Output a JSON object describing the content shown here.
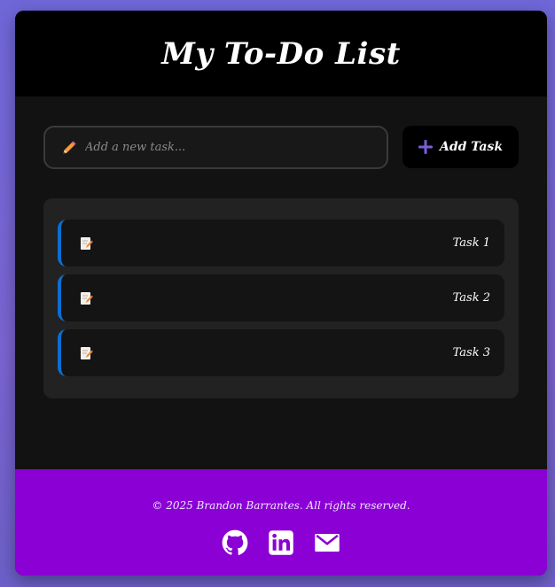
{
  "header": {
    "title": "My To-Do List"
  },
  "input": {
    "placeholder": "Add a new task...",
    "value": ""
  },
  "add_button": {
    "label": "Add Task"
  },
  "tasks": [
    {
      "label": "Task 1"
    },
    {
      "label": "Task 2"
    },
    {
      "label": "Task 3"
    }
  ],
  "footer": {
    "copyright": "© 2025 Brandon Barrantes. All rights reserved.",
    "social_icons": [
      "github-icon",
      "linkedin-icon",
      "email-icon"
    ]
  },
  "colors": {
    "accent_purple": "#8b00d4",
    "task_border_blue": "#0b6fd1",
    "header_bg": "#000000",
    "body_bg": "#121212"
  }
}
